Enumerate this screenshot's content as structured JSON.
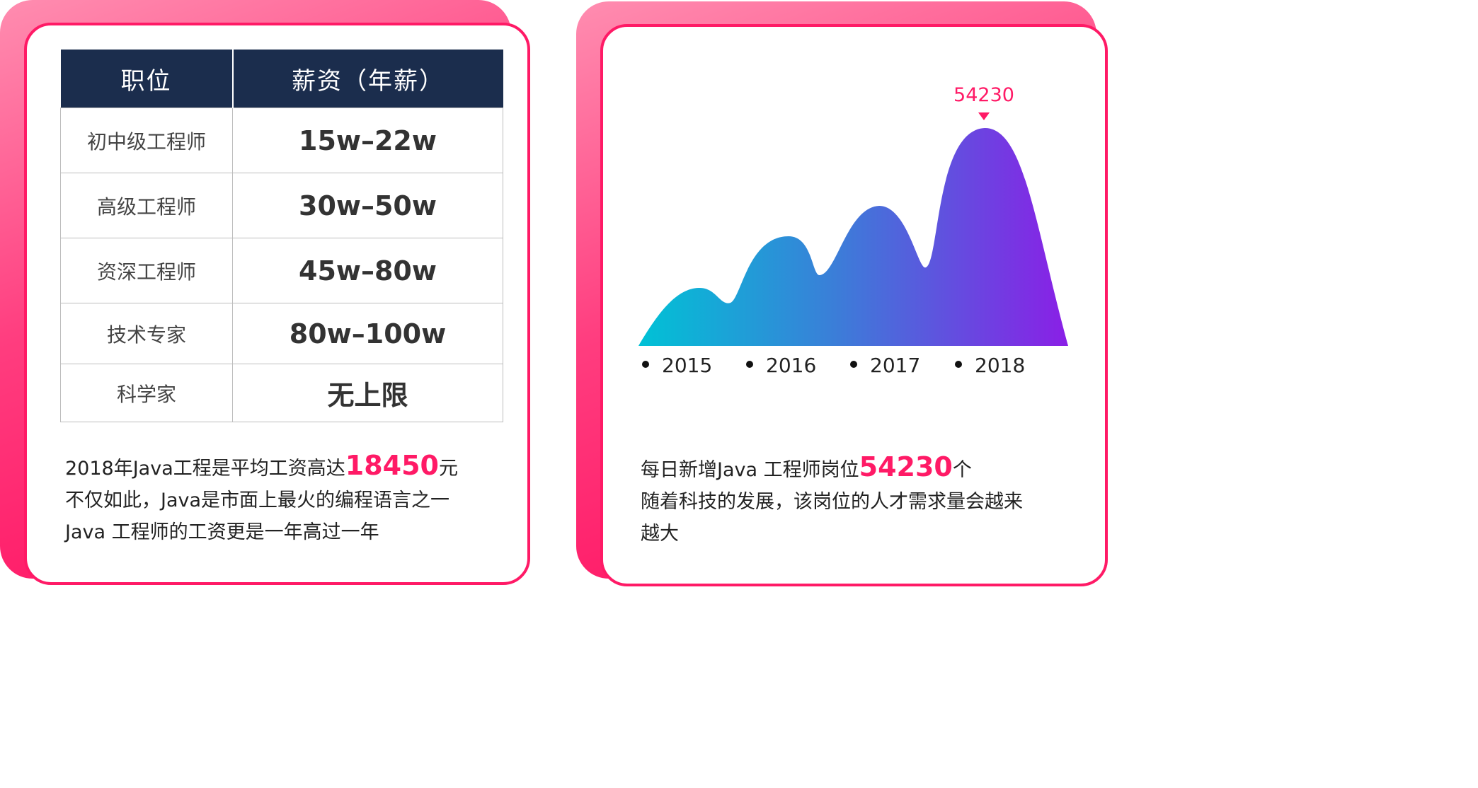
{
  "salary_table": {
    "headers": [
      "职位",
      "薪资（年薪）"
    ],
    "rows": [
      {
        "position": "初中级工程师",
        "salary": "15w–22w"
      },
      {
        "position": "高级工程师",
        "salary": "30w–50w"
      },
      {
        "position": "资深工程师",
        "salary": "45w–80w"
      },
      {
        "position": "技术专家",
        "salary": "80w–100w"
      },
      {
        "position": "科学家",
        "salary": "无上限"
      }
    ]
  },
  "left_text": {
    "line1_pre": "2018年Java工程是平均工资高达",
    "line1_highlight": "18450",
    "line1_post": "元",
    "line2": "不仅如此，Java是市面上最火的编程语言之一",
    "line3": "Java 工程师的工资更是一年高过一年"
  },
  "right_text": {
    "line1_pre": "每日新增Java 工程师岗位",
    "line1_highlight": "54230",
    "line1_post": "个",
    "line2": "随着科技的发展，该岗位的人才需求量会越来",
    "line3": "越大"
  },
  "chart_data": {
    "type": "area",
    "x": [
      "2015",
      "2016",
      "2017",
      "2018"
    ],
    "peak_label": "54230",
    "colors": {
      "start": "#00c2d6",
      "end": "#8a1fe6",
      "accent": "#ff1a66"
    }
  },
  "colors": {
    "accent": "#ff1a66",
    "header_bg": "#1b2d4d"
  }
}
